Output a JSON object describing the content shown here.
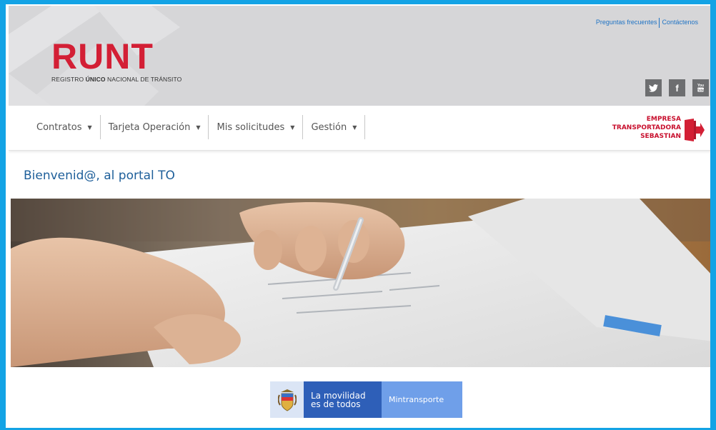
{
  "header": {
    "logo": {
      "word": "RUNT",
      "subtitle_pre": "REGISTRO ",
      "subtitle_bold": "ÚNICO",
      "subtitle_post": " NACIONAL DE TRÁNSITO"
    },
    "top_links": [
      {
        "label": "Preguntas frecuentes"
      },
      {
        "label": "Contáctenos"
      }
    ],
    "social": [
      {
        "name": "twitter-icon",
        "glyph": "🐦"
      },
      {
        "name": "facebook-icon",
        "glyph": "f"
      },
      {
        "name": "youtube-icon",
        "glyph": "You"
      }
    ]
  },
  "nav": {
    "items": [
      {
        "label": "Contratos"
      },
      {
        "label": "Tarjeta Operación"
      },
      {
        "label": "Mis solicitudes"
      },
      {
        "label": "Gestión"
      }
    ],
    "user": {
      "line1": "EMPRESA",
      "line2": "TRANSPORTADORA",
      "line3": "SEBASTIAN"
    }
  },
  "main": {
    "welcome": "Bienvenid@, al portal TO"
  },
  "footer": {
    "gov_line1": "La movilidad",
    "gov_line2": "es de todos",
    "ministry": "Mintransporte"
  },
  "colors": {
    "frame": "#13a3e5",
    "brand_red": "#d31f35",
    "link_blue": "#1f73c4",
    "heading_blue": "#1e5f9a"
  }
}
